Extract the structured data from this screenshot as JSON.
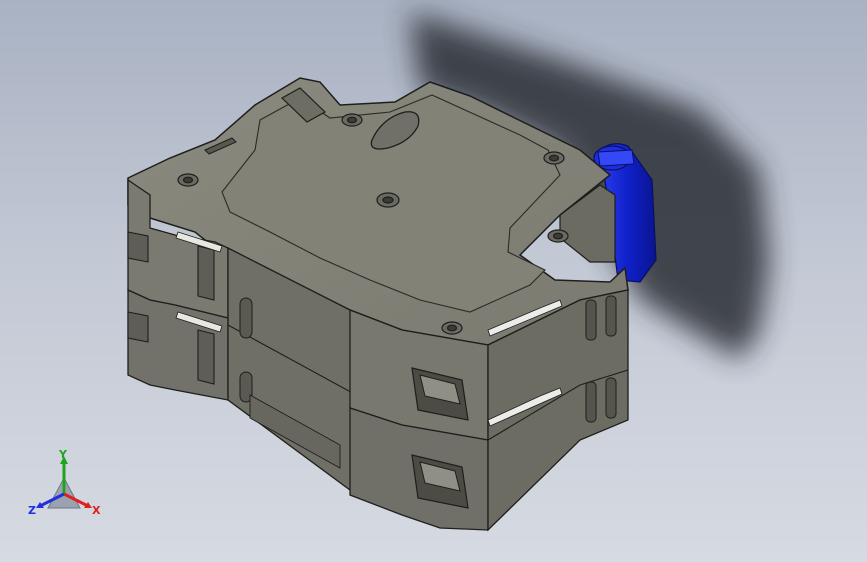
{
  "viewport": {
    "background_top": "#a9b2c3",
    "background_bottom": "#d6dae2"
  },
  "model": {
    "body_color": "#85857a",
    "edge_color": "#1e1e1c",
    "accent_color": "#1d2bd6",
    "shadow_color": "#2b2f36"
  },
  "triad": {
    "x_label": "X",
    "y_label": "Y",
    "z_label": "Z",
    "x_color": "#e02020",
    "y_color": "#1ea51e",
    "z_color": "#2030e0"
  }
}
